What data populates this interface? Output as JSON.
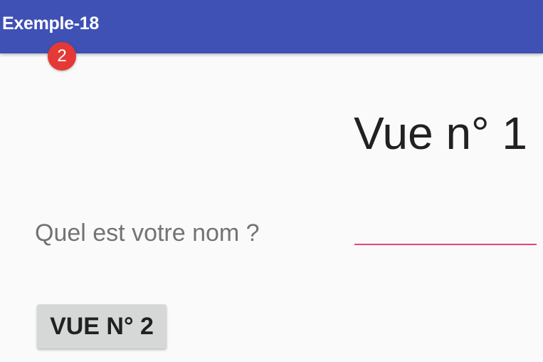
{
  "toolbar": {
    "title": "Exemple-18",
    "badge_count": "2",
    "color": "#3f51b5",
    "badge_color": "#e53935"
  },
  "main": {
    "view_title": "Vue n° 1",
    "name_label": "Quel est votre nom ?",
    "name_input_value": "",
    "name_input_accent": "#ec407a",
    "button_label": "VUE N° 2"
  }
}
